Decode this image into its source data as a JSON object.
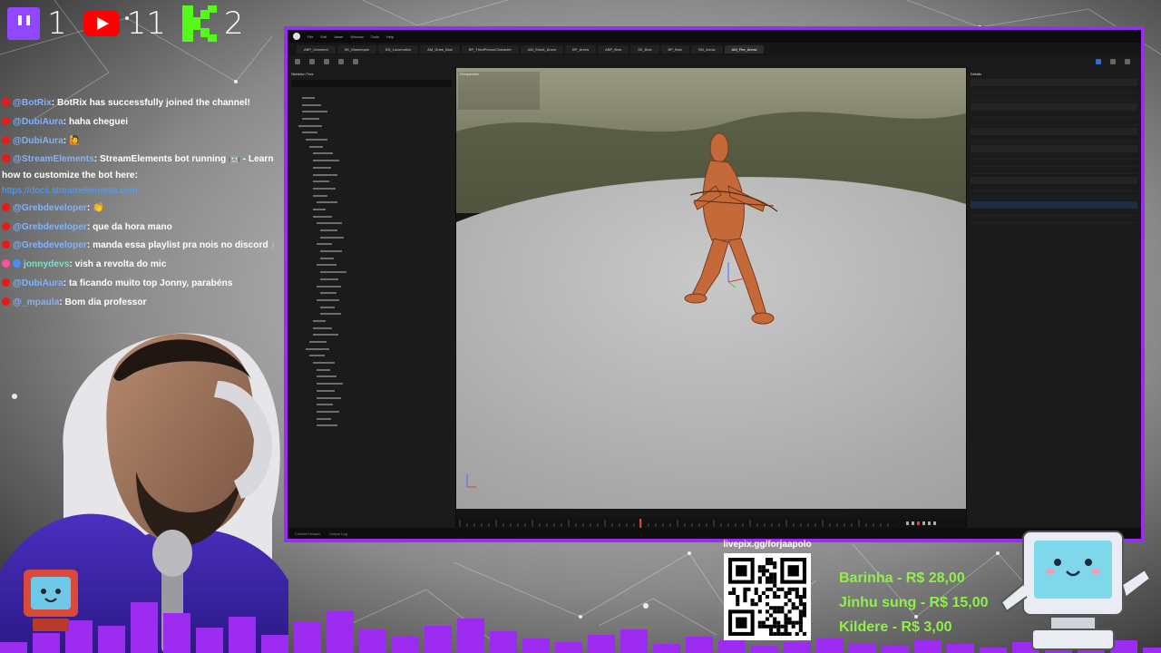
{
  "stats": {
    "twitch_count": "1",
    "youtube_count": "11",
    "kick_count": "2"
  },
  "chat": [
    {
      "user": "@BotRix",
      "text": ": BotRix has successfully joined the channel!"
    },
    {
      "user": "@DubiAura",
      "text": ": haha cheguei"
    },
    {
      "user": "@DubiAura",
      "text": ":"
    },
    {
      "user": "@StreamElements",
      "text": ": StreamElements bot running",
      "text2": " - Learn how to customize the bot here: ",
      "link": "https://docs.streamelements.com"
    },
    {
      "user": "@Grebdeveloper",
      "text": ":"
    },
    {
      "user": "@Grebdeveloper",
      "text": ": que da hora mano"
    },
    {
      "user": "@Grebdeveloper",
      "text": ": manda essa playlist pra nois no discord"
    },
    {
      "user": "jonnydevs",
      "text": ": vish a revolta do mic"
    },
    {
      "user": "@DubiAura",
      "text": ": ta ficando muito top Jonny, parabéns"
    },
    {
      "user": "@_mpaula",
      "text": ": Bom dia professor"
    }
  ],
  "editor": {
    "menu": [
      "File",
      "Edit",
      "Asset",
      "Window",
      "Tools",
      "Help"
    ],
    "tabs": [
      "ABP_Unarmed",
      "SK_Mannequin",
      "BS_Locomotion",
      "AM_Draw_Bow",
      "BP_ThirdPersonCharacter",
      "AM_Shoot_Arrow",
      "BP_Arrow",
      "ABP_Bow",
      "SK_Bow",
      "BP_Bow",
      "SM_Arrow",
      "AM_Fire_Arrow"
    ],
    "outliner_title": "Skeleton Tree",
    "details_title": "Details",
    "viewport_label": "Perspective",
    "status_left": "Content Drawer",
    "status_mid": "Output Log"
  },
  "overlay": {
    "livepix_url": "livepix.gg/forjaapolo",
    "donations": [
      "Barinha - R$ 28,00",
      "Jinhu sung - R$ 15,00",
      "Kildere - R$ 3,00"
    ]
  },
  "colors": {
    "editor_border": "#9b2df0",
    "donation_text": "#8ff04a",
    "chat_user": "#7fb3ff",
    "bars": "#9d2cf0"
  }
}
